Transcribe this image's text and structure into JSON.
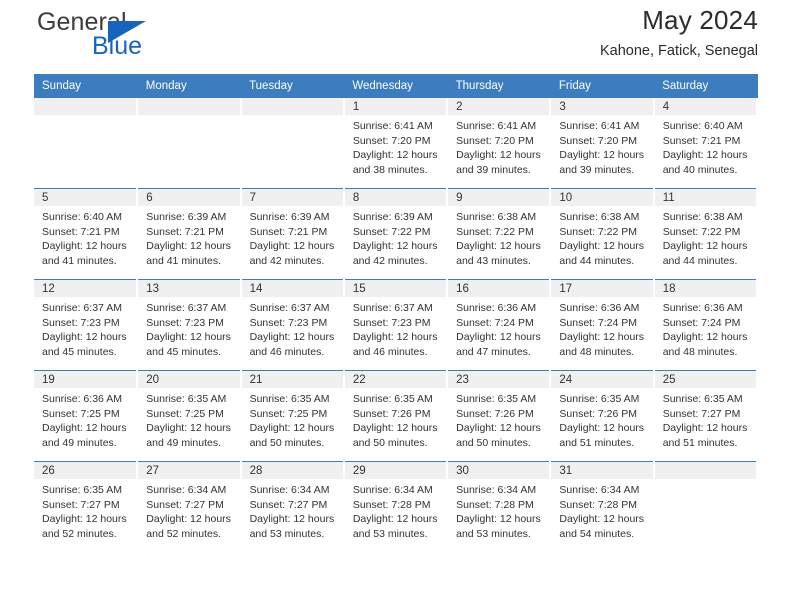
{
  "brand": {
    "name_primary": "General",
    "name_secondary": "Blue",
    "triangle_icon": "triangle-icon",
    "accent_color": "#1565c0"
  },
  "header": {
    "title": "May 2024",
    "subtitle": "Kahone, Fatick, Senegal"
  },
  "theme": {
    "header_bg": "#3b7dbf",
    "header_text": "#ffffff",
    "daynum_bg": "#f0f0f0",
    "row_divider": "#3b7dbf",
    "body_text": "#333333"
  },
  "weekday_headers": [
    "Sunday",
    "Monday",
    "Tuesday",
    "Wednesday",
    "Thursday",
    "Friday",
    "Saturday"
  ],
  "labels": {
    "sunrise": "Sunrise:",
    "sunset": "Sunset:",
    "daylight": "Daylight:"
  },
  "weeks": [
    [
      {
        "day": "",
        "sunrise": "",
        "sunset": "",
        "daylight": ""
      },
      {
        "day": "",
        "sunrise": "",
        "sunset": "",
        "daylight": ""
      },
      {
        "day": "",
        "sunrise": "",
        "sunset": "",
        "daylight": ""
      },
      {
        "day": "1",
        "sunrise": "Sunrise: 6:41 AM",
        "sunset": "Sunset: 7:20 PM",
        "daylight": "Daylight: 12 hours and 38 minutes."
      },
      {
        "day": "2",
        "sunrise": "Sunrise: 6:41 AM",
        "sunset": "Sunset: 7:20 PM",
        "daylight": "Daylight: 12 hours and 39 minutes."
      },
      {
        "day": "3",
        "sunrise": "Sunrise: 6:41 AM",
        "sunset": "Sunset: 7:20 PM",
        "daylight": "Daylight: 12 hours and 39 minutes."
      },
      {
        "day": "4",
        "sunrise": "Sunrise: 6:40 AM",
        "sunset": "Sunset: 7:21 PM",
        "daylight": "Daylight: 12 hours and 40 minutes."
      }
    ],
    [
      {
        "day": "5",
        "sunrise": "Sunrise: 6:40 AM",
        "sunset": "Sunset: 7:21 PM",
        "daylight": "Daylight: 12 hours and 41 minutes."
      },
      {
        "day": "6",
        "sunrise": "Sunrise: 6:39 AM",
        "sunset": "Sunset: 7:21 PM",
        "daylight": "Daylight: 12 hours and 41 minutes."
      },
      {
        "day": "7",
        "sunrise": "Sunrise: 6:39 AM",
        "sunset": "Sunset: 7:21 PM",
        "daylight": "Daylight: 12 hours and 42 minutes."
      },
      {
        "day": "8",
        "sunrise": "Sunrise: 6:39 AM",
        "sunset": "Sunset: 7:22 PM",
        "daylight": "Daylight: 12 hours and 42 minutes."
      },
      {
        "day": "9",
        "sunrise": "Sunrise: 6:38 AM",
        "sunset": "Sunset: 7:22 PM",
        "daylight": "Daylight: 12 hours and 43 minutes."
      },
      {
        "day": "10",
        "sunrise": "Sunrise: 6:38 AM",
        "sunset": "Sunset: 7:22 PM",
        "daylight": "Daylight: 12 hours and 44 minutes."
      },
      {
        "day": "11",
        "sunrise": "Sunrise: 6:38 AM",
        "sunset": "Sunset: 7:22 PM",
        "daylight": "Daylight: 12 hours and 44 minutes."
      }
    ],
    [
      {
        "day": "12",
        "sunrise": "Sunrise: 6:37 AM",
        "sunset": "Sunset: 7:23 PM",
        "daylight": "Daylight: 12 hours and 45 minutes."
      },
      {
        "day": "13",
        "sunrise": "Sunrise: 6:37 AM",
        "sunset": "Sunset: 7:23 PM",
        "daylight": "Daylight: 12 hours and 45 minutes."
      },
      {
        "day": "14",
        "sunrise": "Sunrise: 6:37 AM",
        "sunset": "Sunset: 7:23 PM",
        "daylight": "Daylight: 12 hours and 46 minutes."
      },
      {
        "day": "15",
        "sunrise": "Sunrise: 6:37 AM",
        "sunset": "Sunset: 7:23 PM",
        "daylight": "Daylight: 12 hours and 46 minutes."
      },
      {
        "day": "16",
        "sunrise": "Sunrise: 6:36 AM",
        "sunset": "Sunset: 7:24 PM",
        "daylight": "Daylight: 12 hours and 47 minutes."
      },
      {
        "day": "17",
        "sunrise": "Sunrise: 6:36 AM",
        "sunset": "Sunset: 7:24 PM",
        "daylight": "Daylight: 12 hours and 48 minutes."
      },
      {
        "day": "18",
        "sunrise": "Sunrise: 6:36 AM",
        "sunset": "Sunset: 7:24 PM",
        "daylight": "Daylight: 12 hours and 48 minutes."
      }
    ],
    [
      {
        "day": "19",
        "sunrise": "Sunrise: 6:36 AM",
        "sunset": "Sunset: 7:25 PM",
        "daylight": "Daylight: 12 hours and 49 minutes."
      },
      {
        "day": "20",
        "sunrise": "Sunrise: 6:35 AM",
        "sunset": "Sunset: 7:25 PM",
        "daylight": "Daylight: 12 hours and 49 minutes."
      },
      {
        "day": "21",
        "sunrise": "Sunrise: 6:35 AM",
        "sunset": "Sunset: 7:25 PM",
        "daylight": "Daylight: 12 hours and 50 minutes."
      },
      {
        "day": "22",
        "sunrise": "Sunrise: 6:35 AM",
        "sunset": "Sunset: 7:26 PM",
        "daylight": "Daylight: 12 hours and 50 minutes."
      },
      {
        "day": "23",
        "sunrise": "Sunrise: 6:35 AM",
        "sunset": "Sunset: 7:26 PM",
        "daylight": "Daylight: 12 hours and 50 minutes."
      },
      {
        "day": "24",
        "sunrise": "Sunrise: 6:35 AM",
        "sunset": "Sunset: 7:26 PM",
        "daylight": "Daylight: 12 hours and 51 minutes."
      },
      {
        "day": "25",
        "sunrise": "Sunrise: 6:35 AM",
        "sunset": "Sunset: 7:27 PM",
        "daylight": "Daylight: 12 hours and 51 minutes."
      }
    ],
    [
      {
        "day": "26",
        "sunrise": "Sunrise: 6:35 AM",
        "sunset": "Sunset: 7:27 PM",
        "daylight": "Daylight: 12 hours and 52 minutes."
      },
      {
        "day": "27",
        "sunrise": "Sunrise: 6:34 AM",
        "sunset": "Sunset: 7:27 PM",
        "daylight": "Daylight: 12 hours and 52 minutes."
      },
      {
        "day": "28",
        "sunrise": "Sunrise: 6:34 AM",
        "sunset": "Sunset: 7:27 PM",
        "daylight": "Daylight: 12 hours and 53 minutes."
      },
      {
        "day": "29",
        "sunrise": "Sunrise: 6:34 AM",
        "sunset": "Sunset: 7:28 PM",
        "daylight": "Daylight: 12 hours and 53 minutes."
      },
      {
        "day": "30",
        "sunrise": "Sunrise: 6:34 AM",
        "sunset": "Sunset: 7:28 PM",
        "daylight": "Daylight: 12 hours and 53 minutes."
      },
      {
        "day": "31",
        "sunrise": "Sunrise: 6:34 AM",
        "sunset": "Sunset: 7:28 PM",
        "daylight": "Daylight: 12 hours and 54 minutes."
      },
      {
        "day": "",
        "sunrise": "",
        "sunset": "",
        "daylight": ""
      }
    ]
  ]
}
